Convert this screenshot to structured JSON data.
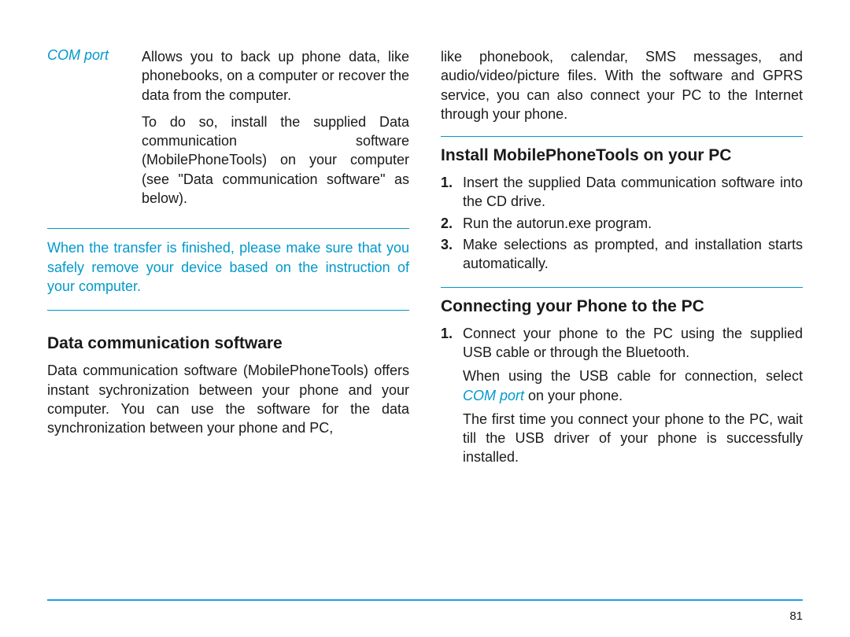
{
  "com_port": {
    "term": "COM port",
    "def1": "Allows you to back up phone data, like phonebooks, on a computer or recover the data from the computer.",
    "def2": "To do so, install the supplied Data communication software (MobilePhoneTools) on your computer (see \"Data communication software\" as below)."
  },
  "note": "When the transfer is finished, please make sure that you safely remove your device based on the instruction of your computer.",
  "data_sw": {
    "heading": "Data communication software",
    "para": "Data communication software (MobilePhoneTools) offers instant sychronization between your phone and your computer. You can use the software for the data synchronization between your phone and PC,",
    "para_cont": "like phonebook, calendar, SMS messages, and audio/video/picture files. With the software and GPRS service, you can also connect your PC to the Internet through your phone."
  },
  "install": {
    "heading": "Install MobilePhoneTools on your PC",
    "items": {
      "n1": "1.",
      "t1": "Insert the supplied Data communication software into the CD drive.",
      "n2": "2.",
      "t2": "Run the autorun.exe program.",
      "n3": "3.",
      "t3": "Make selections as prompted, and installation starts automatically."
    }
  },
  "connect": {
    "heading": "Connecting your Phone to the PC",
    "items": {
      "n1": "1.",
      "t1a": "Connect your phone to the PC using the supplied USB cable or through the Bluetooth.",
      "t1b_pre": "When using the USB cable for connection, select ",
      "t1b_em": "COM port",
      "t1b_post": " on your phone.",
      "t1c": "The first time you connect your phone to the PC, wait till the USB driver of your phone is successfully installed."
    }
  },
  "page_number": "81"
}
